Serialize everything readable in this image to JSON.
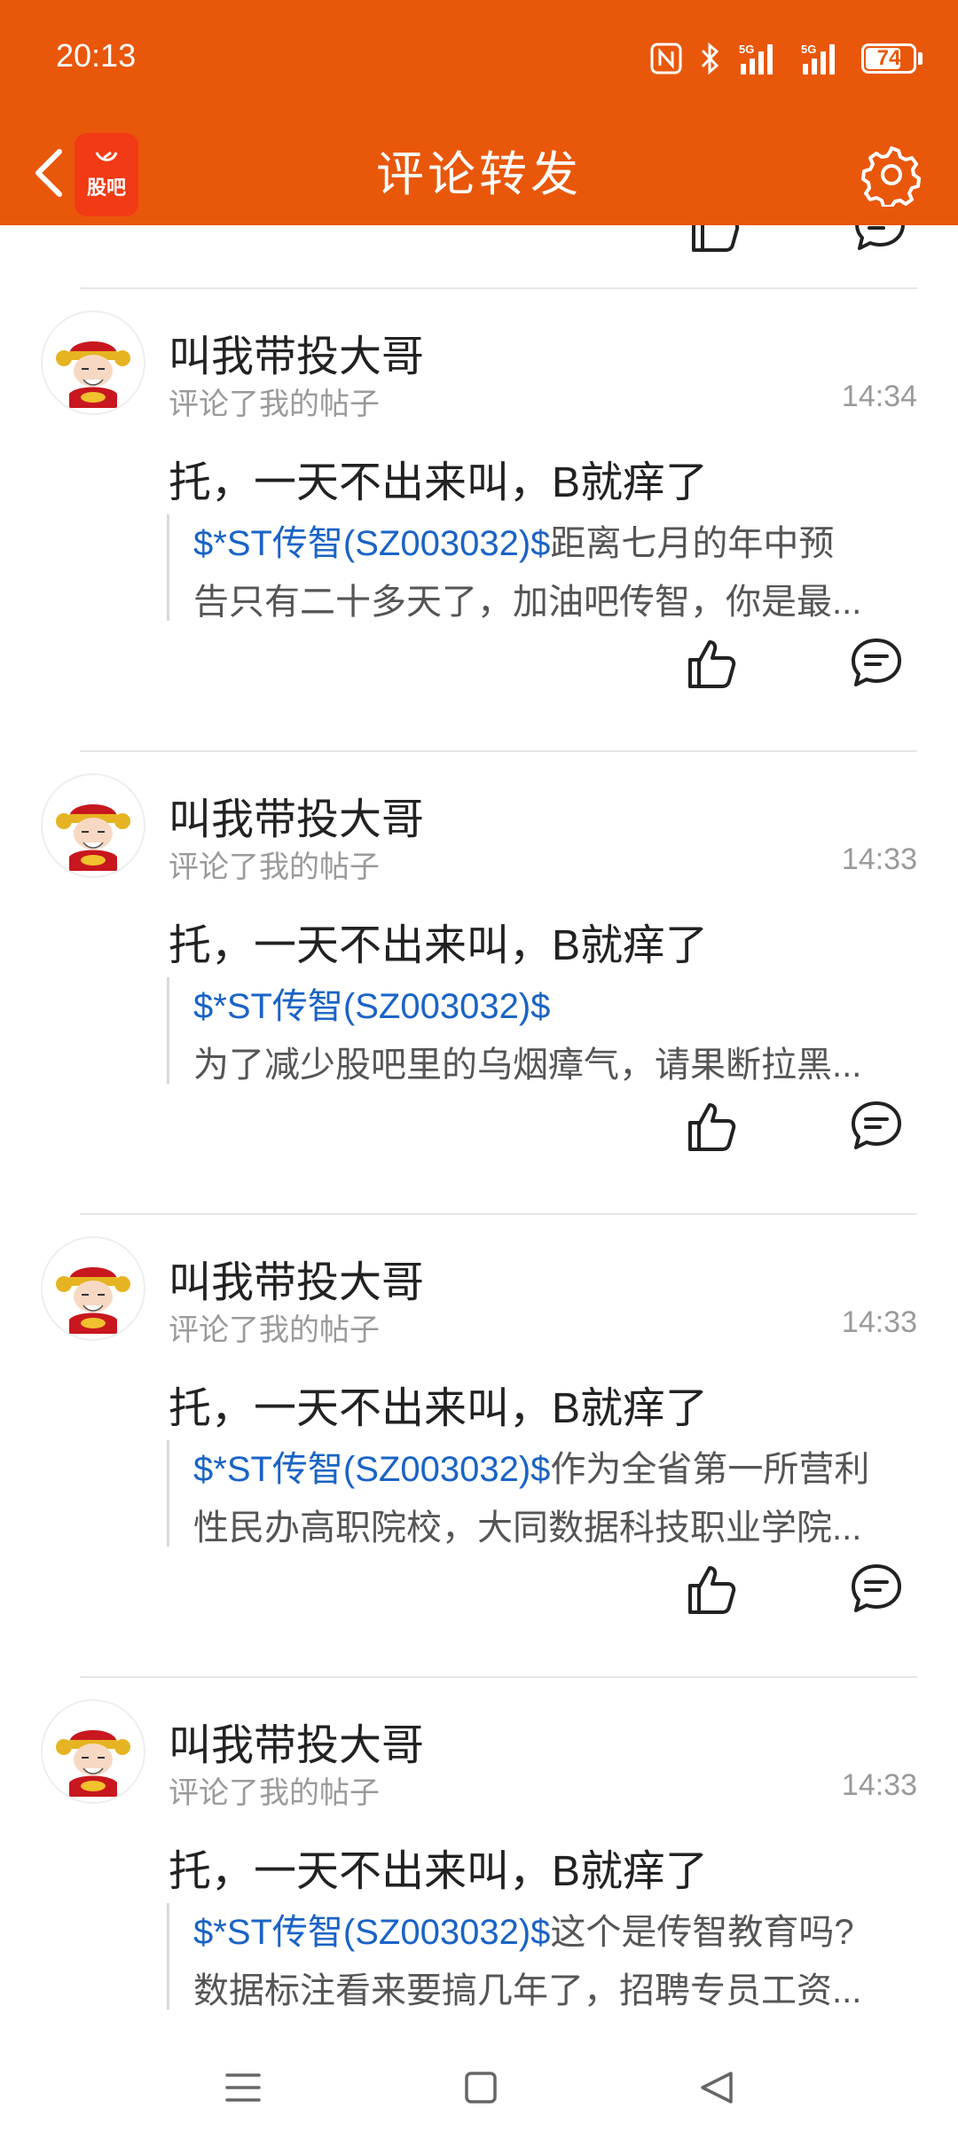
{
  "status_bar": {
    "time": "20:13",
    "battery_level": "74",
    "network_1": "5G",
    "network_2": "5G",
    "icons": [
      "nfc-icon",
      "bluetooth-icon",
      "signal-5g-icon",
      "signal-5g-icon",
      "battery-icon"
    ]
  },
  "header": {
    "title": "评论转发",
    "logo_text": "股吧",
    "bg_color": "#E9570B"
  },
  "comments": [
    {
      "username": "叫我带投大哥",
      "subtitle": "评论了我的帖子",
      "time": "14:34",
      "text": "托，一天不出来叫，B就痒了",
      "quote_stock": "$*ST传智(SZ003032)$",
      "quote_line1_rest": "距离七月的年中预",
      "quote_line2": "告只有二十多天了，加油吧传智，你是最..."
    },
    {
      "username": "叫我带投大哥",
      "subtitle": "评论了我的帖子",
      "time": "14:33",
      "text": "托，一天不出来叫，B就痒了",
      "quote_stock": "$*ST传智(SZ003032)$",
      "quote_line1_rest": "",
      "quote_line2": "为了减少股吧里的乌烟瘴气，请果断拉黑..."
    },
    {
      "username": "叫我带投大哥",
      "subtitle": "评论了我的帖子",
      "time": "14:33",
      "text": "托，一天不出来叫，B就痒了",
      "quote_stock": "$*ST传智(SZ003032)$",
      "quote_line1_rest": "作为全省第一所营利",
      "quote_line2": "性民办高职院校，大同数据科技职业学院..."
    },
    {
      "username": "叫我带投大哥",
      "subtitle": "评论了我的帖子",
      "time": "14:33",
      "text": "托，一天不出来叫，B就痒了",
      "quote_stock": "$*ST传智(SZ003032)$",
      "quote_line1_rest": "这个是传智教育吗?",
      "quote_line2": "数据标注看来要搞几年了，招聘专员工资..."
    }
  ],
  "colors": {
    "accent": "#E9570B",
    "stock_link": "#1A63C6",
    "muted_text": "#9a9a9a"
  }
}
